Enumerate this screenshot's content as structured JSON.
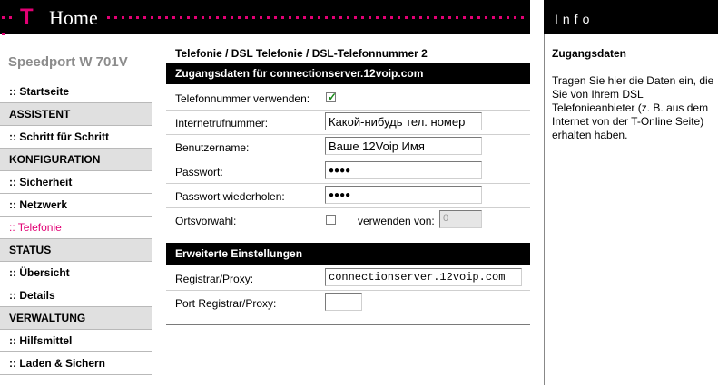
{
  "header": {
    "brand_t": "T",
    "brand_home": "Home"
  },
  "info_header": {
    "title": "Info"
  },
  "sidebar": {
    "product": "Speedport W 701V",
    "items": [
      {
        "label": ":: Startseite",
        "kind": "link"
      },
      {
        "label": "ASSISTENT",
        "kind": "section"
      },
      {
        "label": ":: Schritt für Schritt",
        "kind": "link"
      },
      {
        "label": "KONFIGURATION",
        "kind": "section"
      },
      {
        "label": ":: Sicherheit",
        "kind": "link"
      },
      {
        "label": ":: Netzwerk",
        "kind": "link"
      },
      {
        "label": ":: Telefonie",
        "kind": "link-active"
      },
      {
        "label": "STATUS",
        "kind": "section"
      },
      {
        "label": ":: Übersicht",
        "kind": "link"
      },
      {
        "label": ":: Details",
        "kind": "link"
      },
      {
        "label": "VERWALTUNG",
        "kind": "section"
      },
      {
        "label": ":: Hilfsmittel",
        "kind": "link"
      },
      {
        "label": ":: Laden & Sichern",
        "kind": "link"
      }
    ]
  },
  "main": {
    "breadcrumb": "Telefonie / DSL Telefonie / DSL-Telefonnummer 2",
    "section1_title": "Zugangsdaten für connectionserver.12voip.com",
    "use_number_label": "Telefonnummer verwenden:",
    "use_number_checked": true,
    "internet_number_label": "Internetrufnummer:",
    "internet_number_value": "Какой-нибудь тел. номер",
    "username_label": "Benutzername:",
    "username_value": "Ваше 12Voip Имя",
    "password_label": "Passwort:",
    "password_value": "●●●●",
    "password_repeat_label": "Passwort wiederholen:",
    "password_repeat_value": "●●●●",
    "area_code_label": "Ortsvorwahl:",
    "area_code_checked": false,
    "use_from_label": "verwenden von:",
    "use_from_value": "0",
    "section2_title": "Erweiterte Einstellungen",
    "registrar_label": "Registrar/Proxy:",
    "registrar_value": "connectionserver.12voip.com",
    "port_label": "Port Registrar/Proxy:",
    "port_value": ""
  },
  "info": {
    "subtitle": "Zugangsdaten",
    "text": "Tragen Sie hier die Daten ein, die Sie von Ihrem DSL Telefonieanbieter (z. B. aus dem Internet von der T-Online Seite) erhalten haben."
  },
  "colors": {
    "magenta": "#e20074",
    "black": "#000000",
    "section_gray": "#e0e0e0"
  }
}
